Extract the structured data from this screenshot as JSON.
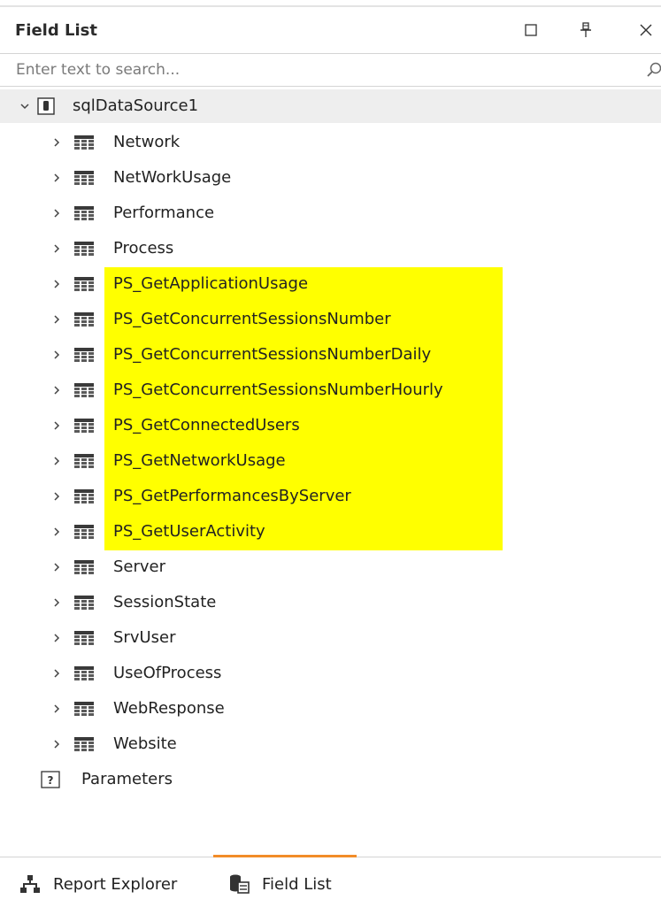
{
  "panel": {
    "title": "Field List",
    "buttons": {
      "maximize_icon": "maximize-icon",
      "pin_icon": "pin-icon",
      "close_icon": "close-icon"
    }
  },
  "search": {
    "placeholder": "Enter text to search...",
    "value": ""
  },
  "tree": {
    "root": {
      "label": "sqlDataSource1",
      "expanded": true,
      "icon": "database-icon"
    },
    "items": [
      {
        "label": "Network",
        "highlighted": false
      },
      {
        "label": "NetWorkUsage",
        "highlighted": false
      },
      {
        "label": "Performance",
        "highlighted": false
      },
      {
        "label": "Process",
        "highlighted": false
      },
      {
        "label": "PS_GetApplicationUsage",
        "highlighted": true
      },
      {
        "label": "PS_GetConcurrentSessionsNumber",
        "highlighted": true
      },
      {
        "label": "PS_GetConcurrentSessionsNumberDaily",
        "highlighted": true
      },
      {
        "label": "PS_GetConcurrentSessionsNumberHourly",
        "highlighted": true
      },
      {
        "label": "PS_GetConnectedUsers",
        "highlighted": true
      },
      {
        "label": "PS_GetNetworkUsage",
        "highlighted": true
      },
      {
        "label": "PS_GetPerformancesByServer",
        "highlighted": true
      },
      {
        "label": "PS_GetUserActivity",
        "highlighted": true
      },
      {
        "label": "Server",
        "highlighted": false
      },
      {
        "label": "SessionState",
        "highlighted": false
      },
      {
        "label": "SrvUser",
        "highlighted": false
      },
      {
        "label": "UseOfProcess",
        "highlighted": false
      },
      {
        "label": "WebResponse",
        "highlighted": false
      },
      {
        "label": "Website",
        "highlighted": false
      }
    ],
    "parameters": {
      "label": "Parameters",
      "icon": "parameters-icon",
      "icon_glyph": "?"
    }
  },
  "tabs": [
    {
      "label": "Report Explorer",
      "icon": "report-explorer-icon",
      "active": false
    },
    {
      "label": "Field List",
      "icon": "field-list-icon",
      "active": true
    }
  ],
  "colors": {
    "highlight": "#ffff00",
    "active_tab": "#f28c28",
    "root_row_bg": "#eeeeee"
  }
}
